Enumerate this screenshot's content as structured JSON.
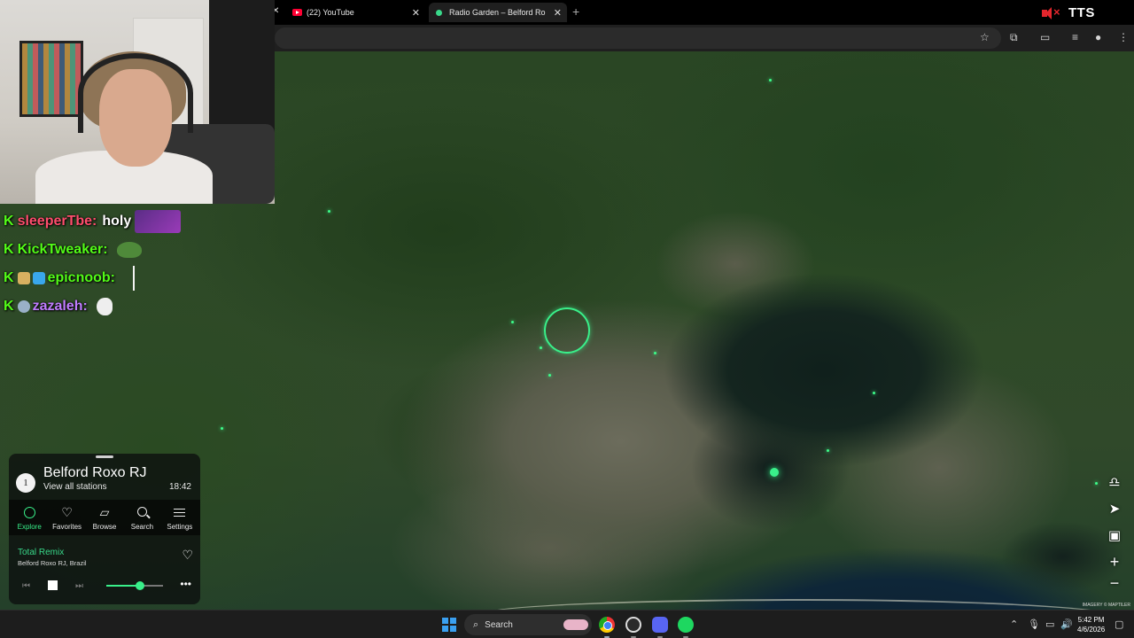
{
  "browser": {
    "tabs": [
      {
        "label": "(22) YouTube"
      },
      {
        "label": "Radio Garden – Belford Ro"
      }
    ],
    "tts_label": "TTS"
  },
  "chat": {
    "messages": [
      {
        "user": "sleeperTbe:",
        "color": "#ff4d6d",
        "text": "holy"
      },
      {
        "user": "KickTweaker:",
        "color": "#53fc18",
        "text": ""
      },
      {
        "user": "epicnoob:",
        "color": "#53fc18",
        "text": ""
      },
      {
        "user": "zazaleh:",
        "color": "#c07cff",
        "text": ""
      }
    ],
    "badge_letter": "K"
  },
  "radio_garden": {
    "station_count": "1",
    "place_name": "Belford Roxo RJ",
    "view_all_label": "View all stations",
    "local_time": "18:42",
    "nav": [
      {
        "label": "Explore",
        "icon": "explore-ring-icon",
        "active": true
      },
      {
        "label": "Favorites",
        "icon": "heart-icon",
        "active": false
      },
      {
        "label": "Browse",
        "icon": "map-icon",
        "active": false
      },
      {
        "label": "Search",
        "icon": "search-icon",
        "active": false
      },
      {
        "label": "Settings",
        "icon": "menu-icon",
        "active": false
      }
    ],
    "now_playing": {
      "title": "Total Remix",
      "location": "Belford Roxo RJ, Brazil"
    },
    "volume_fraction": 0.6
  },
  "map": {
    "credit": "IMAGERY © MAPTILER"
  },
  "taskbar": {
    "search_label": "Search",
    "time": "5:42 PM",
    "date": "4/6/2026"
  },
  "colors": {
    "accent": "#39f08a",
    "kick_green": "#53fc18"
  }
}
